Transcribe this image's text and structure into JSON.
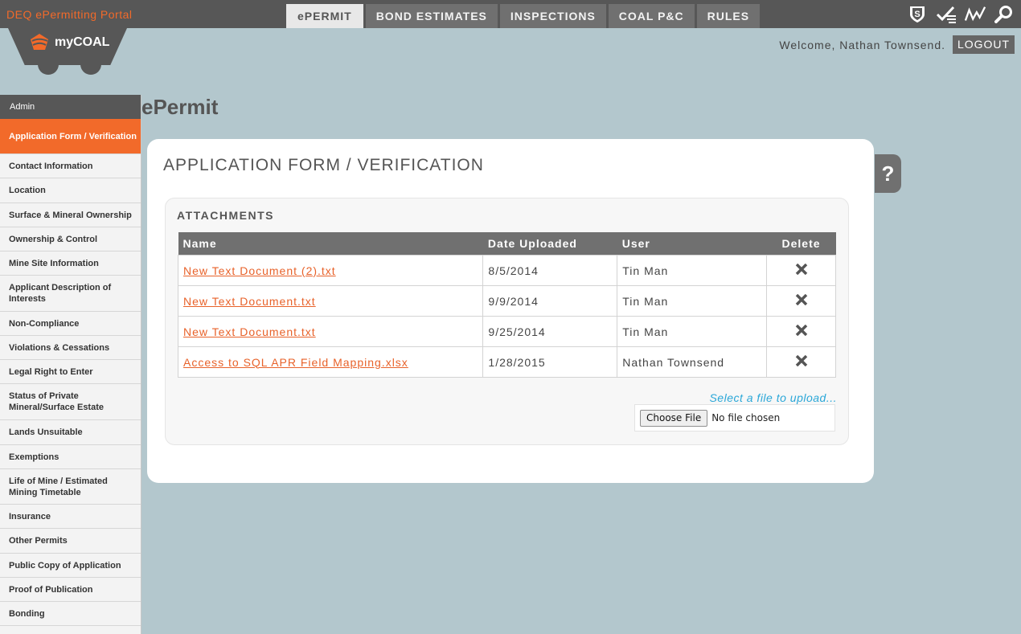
{
  "header": {
    "portal_title": "DEQ ePermitting Portal",
    "tabs": [
      {
        "label": "ePERMIT",
        "active": true
      },
      {
        "label": "BOND ESTIMATES",
        "active": false
      },
      {
        "label": "INSPECTIONS",
        "active": false
      },
      {
        "label": "COAL P&C",
        "active": false
      },
      {
        "label": "RULES",
        "active": false
      }
    ],
    "icons": [
      "shield-s-icon",
      "checklist-icon",
      "chart-line-icon",
      "search-icon"
    ],
    "logo_text": "myCOAL",
    "welcome": "Welcome, Nathan Townsend.",
    "logout": "LOGOUT"
  },
  "sidebar": {
    "header": "Admin",
    "items": [
      {
        "label": "Application Form / Verification",
        "active": true
      },
      {
        "label": "Contact Information"
      },
      {
        "label": "Location"
      },
      {
        "label": "Surface & Mineral Ownership"
      },
      {
        "label": "Ownership & Control"
      },
      {
        "label": "Mine Site Information"
      },
      {
        "label": "Applicant Description of Interests"
      },
      {
        "label": "Non-Compliance"
      },
      {
        "label": "Violations & Cessations"
      },
      {
        "label": "Legal Right to Enter"
      },
      {
        "label": "Status of Private Mineral/Surface Estate"
      },
      {
        "label": "Lands Unsuitable"
      },
      {
        "label": "Exemptions"
      },
      {
        "label": "Life of Mine / Estimated Mining Timetable"
      },
      {
        "label": "Insurance"
      },
      {
        "label": "Other Permits"
      },
      {
        "label": "Public Copy of Application"
      },
      {
        "label": "Proof of Publication"
      },
      {
        "label": "Bonding"
      }
    ]
  },
  "main": {
    "page_heading": "ePermit",
    "card_title": "APPLICATION FORM / VERIFICATION",
    "help_label": "?",
    "attachments": {
      "title": "ATTACHMENTS",
      "columns": [
        "Name",
        "Date Uploaded",
        "User",
        "Delete"
      ],
      "rows": [
        {
          "name": "New Text Document (2).txt",
          "date": "8/5/2014",
          "user": "Tin Man"
        },
        {
          "name": "New Text Document.txt",
          "date": "9/9/2014",
          "user": "Tin Man"
        },
        {
          "name": "New Text Document.txt",
          "date": "9/25/2014",
          "user": "Tin Man"
        },
        {
          "name": "Access to SQL APR Field Mapping.xlsx",
          "date": "1/28/2015",
          "user": "Nathan Townsend"
        }
      ],
      "upload_label": "Select a file to upload...",
      "choose_file": "Choose File",
      "no_file": "No file chosen"
    }
  },
  "colors": {
    "accent": "#f26a2a",
    "bar": "#575757",
    "background": "#b3c7cd",
    "upload_link": "#2aa7d8"
  }
}
